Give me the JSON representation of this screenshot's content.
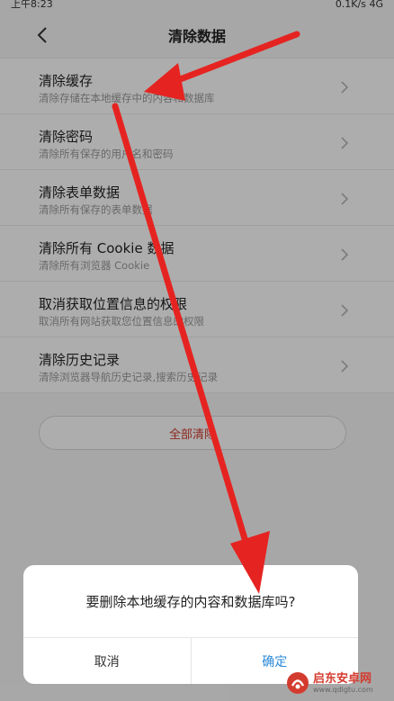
{
  "status_bar": {
    "time": "上午8:23",
    "speed": "0.1K/s",
    "network": "4G"
  },
  "header": {
    "title": "清除数据"
  },
  "items": [
    {
      "title": "清除缓存",
      "subtitle": "清除存储在本地缓存中的内容和数据库"
    },
    {
      "title": "清除密码",
      "subtitle": "清除所有保存的用户名和密码"
    },
    {
      "title": "清除表单数据",
      "subtitle": "清除所有保存的表单数据"
    },
    {
      "title": "清除所有 Cookie 数据",
      "subtitle": "清除所有浏览器 Cookie"
    },
    {
      "title": "取消获取位置信息的权限",
      "subtitle": "取消所有网站获取您位置信息的权限"
    },
    {
      "title": "清除历史记录",
      "subtitle": "清除浏览器导航历史记录,搜索历史记录"
    }
  ],
  "clear_all": {
    "label": "全部清除"
  },
  "dialog": {
    "message": "要删除本地缓存的内容和数据库吗?",
    "cancel_label": "取消",
    "confirm_label": "确定"
  },
  "watermark": {
    "title": "启东安卓网",
    "url": "www.qdlgtu.com"
  },
  "colors": {
    "accent_red": "#d23c30",
    "confirm_blue": "#2a8ad8",
    "arrow_red": "#e52421"
  }
}
